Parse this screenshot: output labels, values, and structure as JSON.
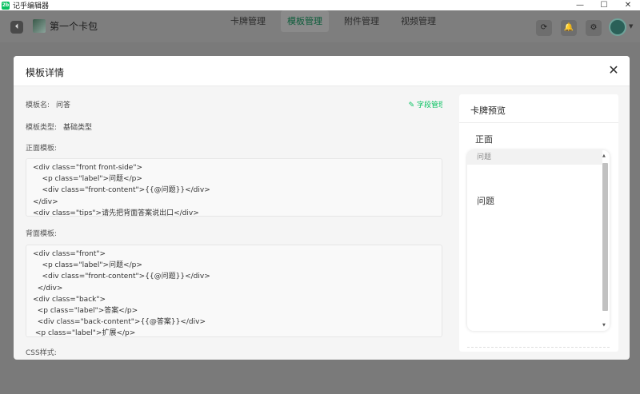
{
  "window": {
    "app_icon_text": "2b",
    "title": "记乎编辑器",
    "controls": {
      "minimize": "—",
      "maximize": "☐",
      "close": "✕"
    }
  },
  "header": {
    "back_icon": "⏴",
    "deck_name": "第一个卡包",
    "tabs": [
      {
        "label": "卡牌管理",
        "active": false
      },
      {
        "label": "模板管理",
        "active": true
      },
      {
        "label": "附件管理",
        "active": false
      },
      {
        "label": "视频管理",
        "active": false
      }
    ],
    "icons": {
      "refresh": "⟳",
      "bell": "🔔",
      "gear": "⚙",
      "caret": "▼"
    }
  },
  "modal": {
    "title": "模板详情",
    "close_icon": "✕",
    "template_name_label": "模板名:",
    "template_name_value": "问答",
    "template_type_label": "模板类型:",
    "template_type_value": "基础类型",
    "field_manage_label": "字段管理",
    "field_manage_icon": "✎",
    "front_label": "正面模板:",
    "front_code": [
      "<div class=\"front front-side\">",
      "    <p class=\"label\">问题</p>",
      "    <div class=\"front-content\">{{@问题}}</div>",
      "</div>",
      "<div class=\"tips\">请先把背面答案说出口</div>"
    ],
    "back_label": "背面模板:",
    "back_code": [
      "<div class=\"front\">",
      "    <p class=\"label\">问题</p>",
      "    <div class=\"front-content\">{{@问题}}</div>",
      "  </div>",
      "<div class=\"back\">",
      "  <p class=\"label\">答案</p>",
      "  <div class=\"back-content\">{{@答案}}</div>",
      " <p class=\"label\">扩展</p>"
    ],
    "css_label": "CSS样式:"
  },
  "preview": {
    "title": "卡牌预览",
    "face": "正面",
    "card_label": "问题",
    "card_content": "问题",
    "scroll_up": "▲",
    "scroll_down": "▼"
  }
}
